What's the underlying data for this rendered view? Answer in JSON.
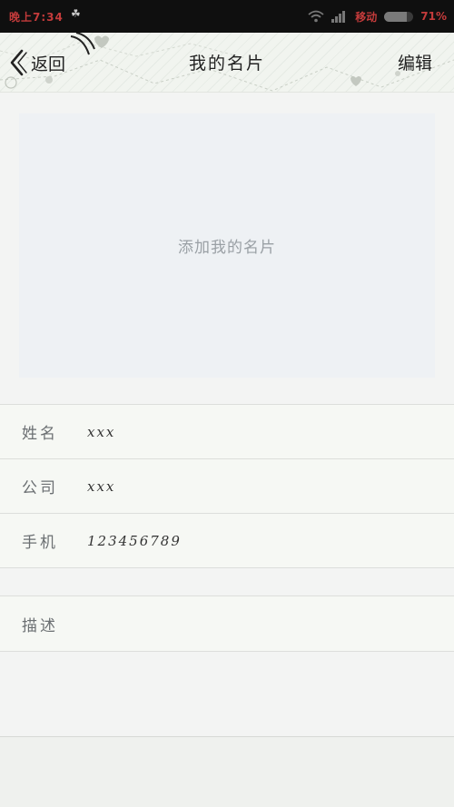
{
  "status_bar": {
    "time": "晚上7:34",
    "notification": "☘",
    "carrier": "移动",
    "battery_percent": "71%",
    "battery_level": 0.78
  },
  "header": {
    "back_label": "返回",
    "title": "我的名片",
    "edit_label": "编辑"
  },
  "card": {
    "placeholder": "添加我的名片"
  },
  "info": {
    "rows": [
      {
        "label": "姓名",
        "value": "xxx"
      },
      {
        "label": "公司",
        "value": "xxx"
      },
      {
        "label": "手机",
        "value": "123456789"
      }
    ]
  },
  "description": {
    "label": "描述"
  },
  "colors": {
    "status_bar_bg": "#0f0f0f",
    "status_text": "#c43b3b",
    "card_bg": "#eef1f4",
    "page_bg": "#f3f4f3"
  }
}
